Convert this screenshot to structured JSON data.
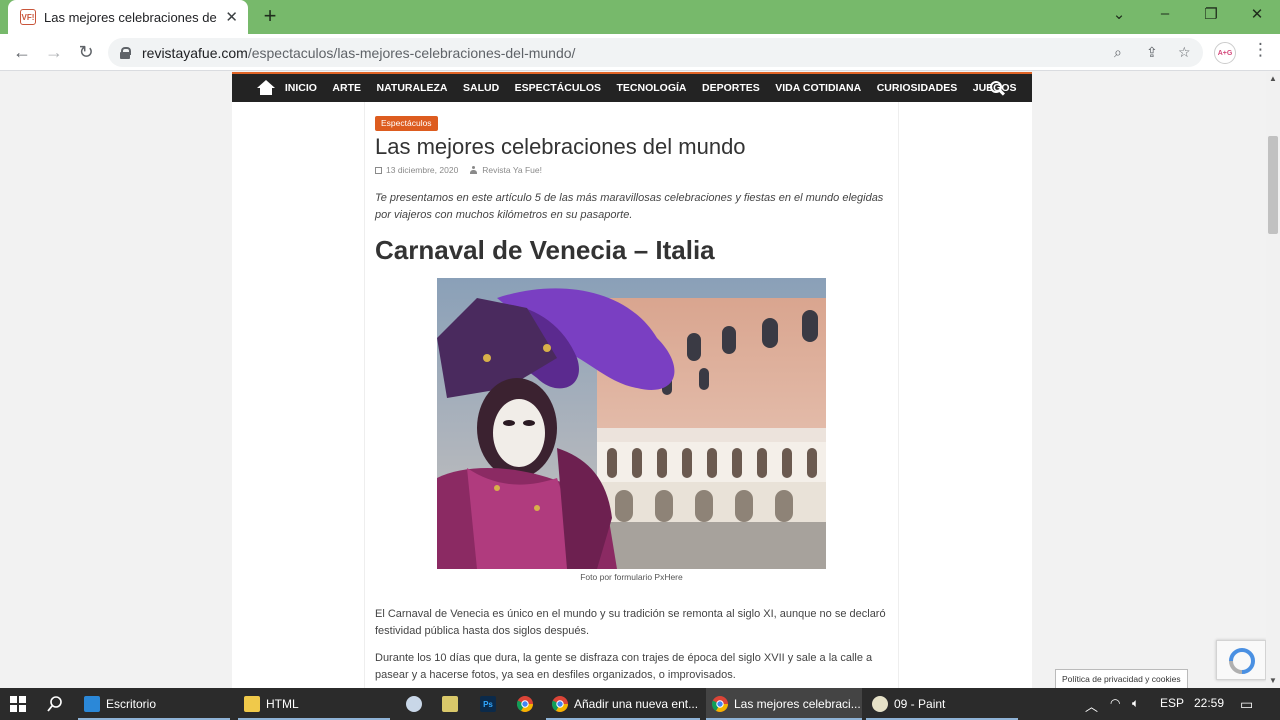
{
  "browser": {
    "tab_title": "Las mejores celebraciones del mu",
    "tab_favicon_text": "VF!",
    "new_tab_label": "+",
    "url_domain": "revistayafue.com",
    "url_path": "/espectaculos/las-mejores-celebraciones-del-mundo/",
    "profile_text": "A+G",
    "window_controls": [
      "⌄",
      "–",
      "❐",
      "✕"
    ]
  },
  "site_nav": {
    "items": [
      "INICIO",
      "ARTE",
      "NATURALEZA",
      "SALUD",
      "ESPECTÁCULOS",
      "TECNOLOGÍA",
      "DEPORTES",
      "VIDA COTIDIANA",
      "CURIOSIDADES",
      "JUEGOS"
    ]
  },
  "article": {
    "category": "Espectáculos",
    "title": "Las mejores celebraciones del mundo",
    "date": "13 diciembre, 2020",
    "author": "Revista Ya Fue!",
    "intro": "Te presentamos en este artículo 5 de las más maravillosas celebraciones y fiestas en el mundo elegidas por viajeros con muchos kilómetros en su pasaporte.",
    "section_heading": "Carnaval de Venecia – Italia",
    "photo_caption": "Foto por formulario PxHere",
    "paragraphs": [
      "El Carnaval de Venecia es único en el mundo y su tradición se remonta al siglo XI, aunque no se declaró festividad pública hasta dos siglos después.",
      "Durante los 10 días que dura, la gente se disfraza con trajes de época del siglo XVII y sale a la calle a pasear y a hacerse fotos, ya sea en desfiles organizados, o improvisados."
    ]
  },
  "overlays": {
    "cookie_label": "Política de privacidad y cookies"
  },
  "taskbar": {
    "buttons": [
      "Escritorio",
      "HTML",
      "Añadir una nueva ent...",
      "Las mejores celebraci...",
      "09 - Paint"
    ],
    "tray_lang": "ESP",
    "clock": "22:59"
  },
  "colors": {
    "tabstrip": "#77b96b",
    "nav_bg": "#232323",
    "accent": "#dd5c1f",
    "taskbar": "#2b2b2b"
  }
}
